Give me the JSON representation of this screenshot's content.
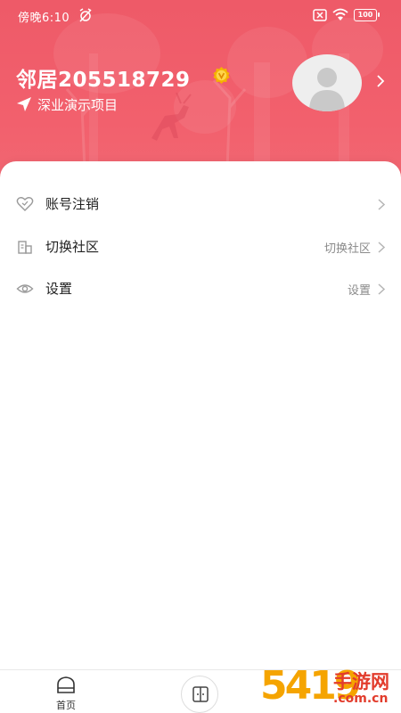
{
  "status_bar": {
    "time": "傍晚6:10",
    "battery": "100"
  },
  "profile": {
    "name": "邻居205518729",
    "project": "深业演示项目"
  },
  "menu": [
    {
      "label": "账号注销",
      "value": "",
      "icon": "heart-outline-icon"
    },
    {
      "label": "切换社区",
      "value": "切换社区",
      "icon": "building-icon"
    },
    {
      "label": "设置",
      "value": "设置",
      "icon": "eye-icon"
    }
  ],
  "tabbar": {
    "home_label": "首页"
  },
  "watermark": {
    "digits": "5419",
    "text": "手游网",
    "domain": ".com.cn"
  },
  "colors": {
    "header": "#f2606d",
    "badge": "#f5b300",
    "watermark_orange": "#f5a400",
    "watermark_red": "#e23c2c"
  }
}
